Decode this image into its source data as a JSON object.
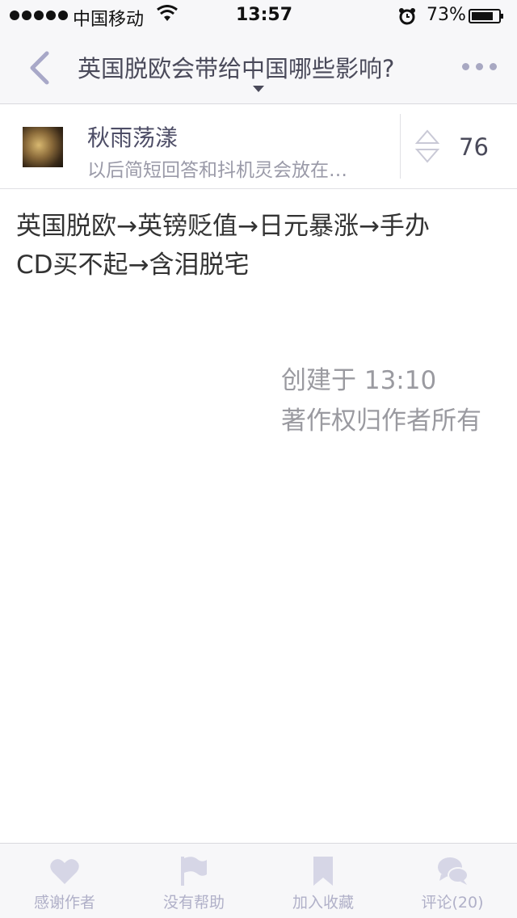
{
  "status_bar": {
    "carrier": "中国移动",
    "time": "13:57",
    "battery": "73%"
  },
  "nav": {
    "title": "英国脱欧会带给中国哪些影响?"
  },
  "author": {
    "name": "秋雨荡漾",
    "bio": "以后简短回答和抖机灵会放在…",
    "votes": "76"
  },
  "answer": {
    "line1": "英国脱欧→英镑贬值→日元暴涨→手办",
    "line2": "CD买不起→含泪脱宅",
    "created": "创建于 13:10",
    "copyright": "著作权归作者所有"
  },
  "toolbar": {
    "thank": "感谢作者",
    "no_help": "没有帮助",
    "collect": "加入收藏",
    "comments": "评论(20)"
  },
  "colors": {
    "accent": "#a8a8c8",
    "title": "#4a4a5a"
  }
}
